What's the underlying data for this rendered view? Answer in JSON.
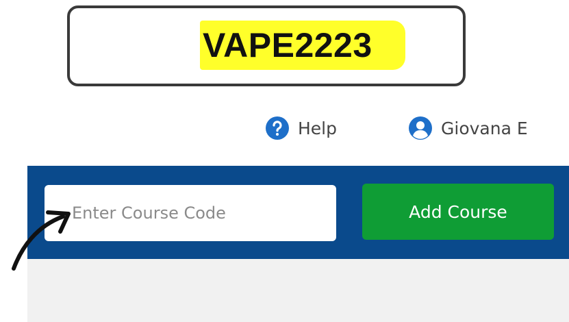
{
  "callout": {
    "code": "VAPE2223",
    "highlight_color": "#ffff2a"
  },
  "header": {
    "help_label": "Help",
    "help_icon": "help-circle-icon",
    "user_name": "Giovana E",
    "user_icon": "user-avatar-icon"
  },
  "course_bar": {
    "input_placeholder": "Enter Course Code",
    "input_value": "",
    "add_button_label": "Add Course",
    "bar_color": "#0a4a8c",
    "button_color": "#0f9d35"
  },
  "annotation": {
    "arrow_icon": "pointer-arrow-icon"
  }
}
